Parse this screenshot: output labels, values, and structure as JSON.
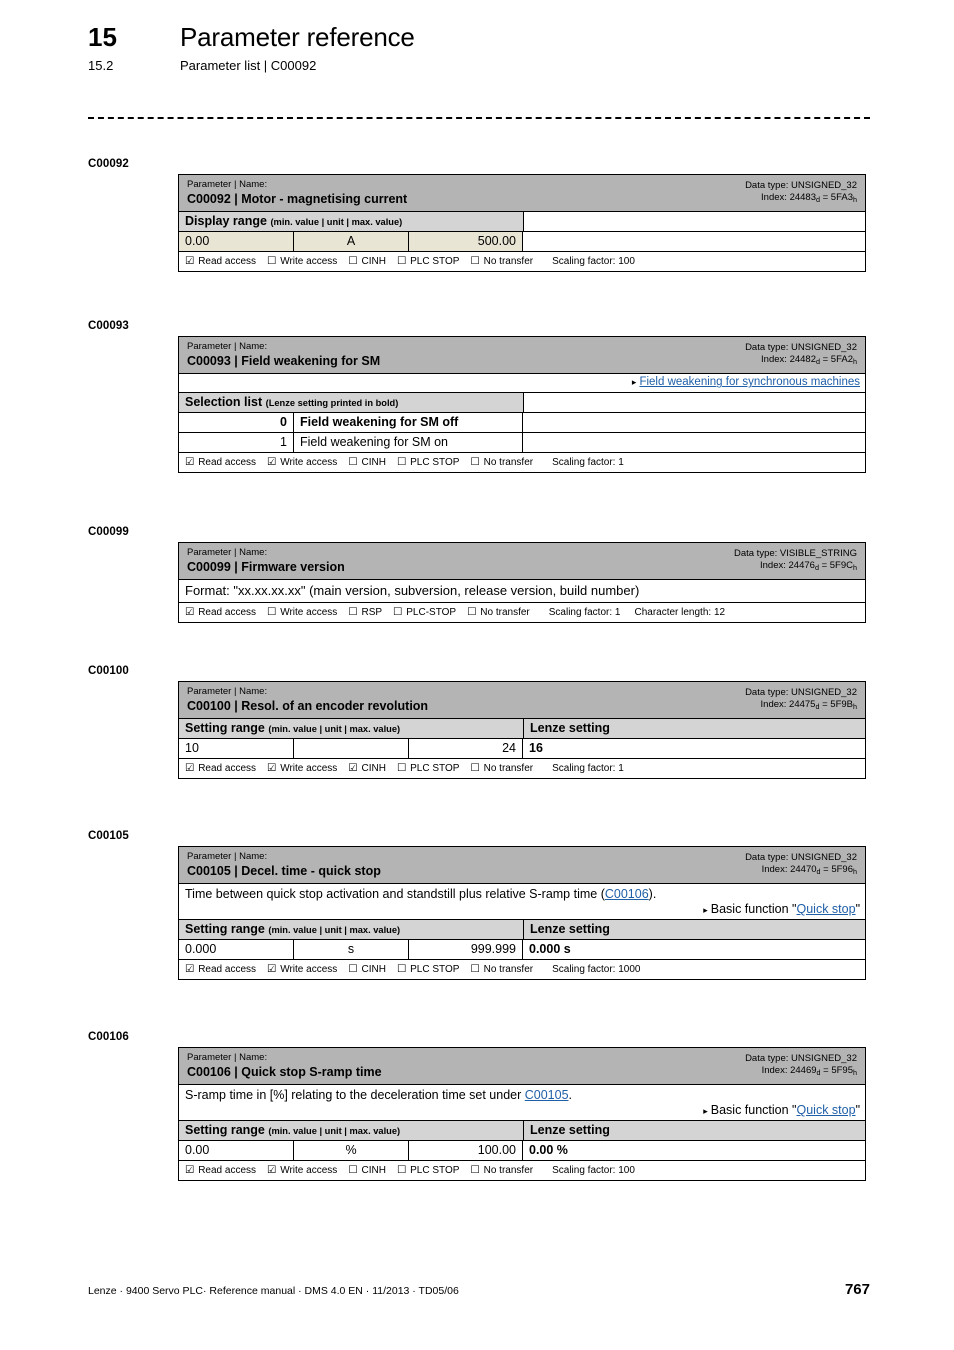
{
  "header": {
    "chapter_number": "15",
    "chapter_title": "Parameter reference",
    "section_number": "15.2",
    "section_title": "Parameter list | C00092"
  },
  "labels": {
    "param_name_caption": "Parameter | Name:",
    "display_range": "Display range",
    "setting_range": "Setting range",
    "range_hint": "(min. value | unit | max. value)",
    "selection_list": "Selection list",
    "selection_hint": "(Lenze setting printed in bold)",
    "lenze_setting": "Lenze setting",
    "read_access": "Read access",
    "write_access": "Write access",
    "cinh": "CINH",
    "rsp": "RSP",
    "plc_stop": "PLC STOP",
    "plc_stop_hyphen": "PLC-STOP",
    "no_transfer": "No transfer",
    "checked_box": "☑",
    "unchecked_box": "☐",
    "triangle": "▸",
    "basic_function_prefix": "Basic function \"",
    "quote_close": "\""
  },
  "blocks": [
    {
      "code": "C00092",
      "name": "C00092 | Motor - magnetising current",
      "data_type": "Data type: UNSIGNED_32",
      "index_prefix": "Index: 24483",
      "index_mid": " = 5FA3",
      "range_kind": "display",
      "value_style": "beige",
      "min": "0.00",
      "unit": "A",
      "max": "500.00",
      "lenze": "",
      "lenze_header_blank": true,
      "flags": {
        "read": true,
        "write": false,
        "cinh": false,
        "plc": false,
        "transfer": false
      },
      "plc_label": "PLC STOP",
      "third_flag": "CINH",
      "scaling": "Scaling factor: 100",
      "char_length": ""
    },
    {
      "code": "C00093",
      "name": "C00093 | Field weakening for SM",
      "data_type": "Data type: UNSIGNED_32",
      "index_prefix": "Index: 24482",
      "index_mid": " = 5FA2",
      "link_row": "Field weakening for synchronous machines",
      "range_kind": "selection",
      "selection": [
        {
          "index": "0",
          "text": "Field weakening for SM off",
          "bold": true
        },
        {
          "index": "1",
          "text": "Field weakening for SM on",
          "bold": false
        }
      ],
      "flags": {
        "read": true,
        "write": true,
        "cinh": false,
        "plc": false,
        "transfer": false
      },
      "plc_label": "PLC STOP",
      "third_flag": "CINH",
      "scaling": "Scaling factor: 1",
      "char_length": ""
    },
    {
      "code": "C00099",
      "name": "C00099 | Firmware version",
      "data_type": "Data type: VISIBLE_STRING",
      "index_prefix": "Index: 24476",
      "index_mid": " = 5F9C",
      "range_kind": "format",
      "format_text": "Format: \"xx.xx.xx.xx\" (main version, subversion, release version, build number)",
      "flags": {
        "read": true,
        "write": false,
        "cinh": false,
        "plc": false,
        "transfer": false
      },
      "plc_label": "PLC-STOP",
      "third_flag": "RSP",
      "scaling": "Scaling factor: 1",
      "char_length": "Character length: 12"
    },
    {
      "code": "C00100",
      "name": "C00100 | Resol. of an encoder revolution",
      "data_type": "Data type: UNSIGNED_32",
      "index_prefix": "Index: 24475",
      "index_mid": " = 5F9B",
      "range_kind": "setting",
      "value_style": "plain",
      "min": "10",
      "unit": "",
      "max": "24",
      "lenze": "16",
      "flags": {
        "read": true,
        "write": true,
        "cinh": true,
        "plc": false,
        "transfer": false
      },
      "plc_label": "PLC STOP",
      "third_flag": "CINH",
      "scaling": "Scaling factor: 1",
      "char_length": ""
    },
    {
      "code": "C00105",
      "name": "C00105 | Decel. time - quick stop",
      "data_type": "Data type: UNSIGNED_32",
      "index_prefix": "Index: 24470",
      "index_mid": " = 5F96",
      "desc_pre": "Time between quick stop activation and standstill plus relative S-ramp time (",
      "desc_link": "C00106",
      "desc_post": ").",
      "basic_function_link": "Quick stop",
      "range_kind": "setting",
      "value_style": "plain",
      "min": "0.000",
      "unit": "s",
      "max": "999.999",
      "lenze": "0.000 s",
      "flags": {
        "read": true,
        "write": true,
        "cinh": false,
        "plc": false,
        "transfer": false
      },
      "plc_label": "PLC STOP",
      "third_flag": "CINH",
      "scaling": "Scaling factor: 1000",
      "char_length": ""
    },
    {
      "code": "C00106",
      "name": "C00106 | Quick stop S-ramp time",
      "data_type": "Data type: UNSIGNED_32",
      "index_prefix": "Index: 24469",
      "index_mid": " = 5F95",
      "desc_pre": "S-ramp time in [%] relating to the deceleration time set under ",
      "desc_link": "C00105",
      "desc_post": ".",
      "basic_function_link": "Quick stop",
      "range_kind": "setting",
      "value_style": "plain",
      "min": "0.00",
      "unit": "%",
      "max": "100.00",
      "lenze": "0.00 %",
      "flags": {
        "read": true,
        "write": true,
        "cinh": false,
        "plc": false,
        "transfer": false
      },
      "plc_label": "PLC STOP",
      "third_flag": "CINH",
      "scaling": "Scaling factor: 100",
      "char_length": ""
    }
  ],
  "footer": {
    "text": "Lenze · 9400 Servo PLC· Reference manual · DMS 4.0 EN · 11/2013 · TD05/06",
    "page": "767"
  },
  "colors": {
    "header_bar": "#b4b4b4",
    "sub_header": "#d4d4d4",
    "value_beige": "#e9e5d5",
    "link_blue": "#1f5fa8"
  }
}
